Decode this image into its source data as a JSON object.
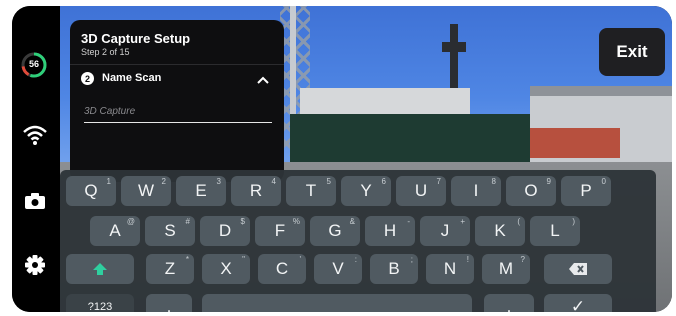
{
  "setup": {
    "title": "3D Capture Setup",
    "step": "Step 2 of 15",
    "section_number": "2",
    "section_label": "Name Scan",
    "input_placeholder": "3D Capture"
  },
  "exit_label": "Exit",
  "battery_level": "56",
  "colors": {
    "accent": "#2fcf7a",
    "key": "#505a61",
    "keyboard_bg": "#2e3438",
    "panel_bg": "#0e0e10"
  },
  "keyboard": {
    "row1": [
      {
        "l": "Q",
        "h": "1"
      },
      {
        "l": "W",
        "h": "2"
      },
      {
        "l": "E",
        "h": "3"
      },
      {
        "l": "R",
        "h": "4"
      },
      {
        "l": "T",
        "h": "5"
      },
      {
        "l": "Y",
        "h": "6"
      },
      {
        "l": "U",
        "h": "7"
      },
      {
        "l": "I",
        "h": "8"
      },
      {
        "l": "O",
        "h": "9"
      },
      {
        "l": "P",
        "h": "0"
      }
    ],
    "row2": [
      {
        "l": "A",
        "h": "@"
      },
      {
        "l": "S",
        "h": "#"
      },
      {
        "l": "D",
        "h": "$"
      },
      {
        "l": "F",
        "h": "%"
      },
      {
        "l": "G",
        "h": "&"
      },
      {
        "l": "H",
        "h": "-"
      },
      {
        "l": "J",
        "h": "+"
      },
      {
        "l": "K",
        "h": "("
      },
      {
        "l": "L",
        "h": ")"
      }
    ],
    "row3": [
      {
        "l": "Z",
        "h": "*"
      },
      {
        "l": "X",
        "h": "\""
      },
      {
        "l": "C",
        "h": "'"
      },
      {
        "l": "V",
        "h": ":"
      },
      {
        "l": "B",
        "h": ";"
      },
      {
        "l": "N",
        "h": "!"
      },
      {
        "l": "M",
        "h": "?"
      }
    ],
    "symbols_label": "?123",
    "comma": ",",
    "period": ".",
    "done_glyph": "✓"
  }
}
